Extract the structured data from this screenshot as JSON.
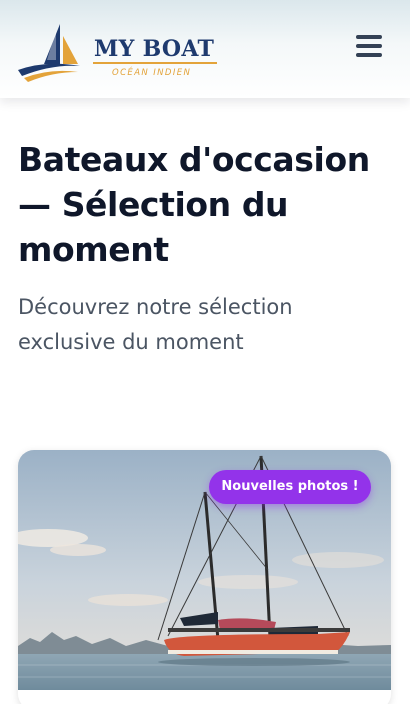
{
  "header": {
    "logo": {
      "title": "MY BOAT",
      "subtitle": "OCÉAN INDIEN",
      "icon": "sailboat-logo-icon"
    },
    "menu_icon": "hamburger-menu-icon"
  },
  "main": {
    "title": "Bateaux d'occasion — Sélection du moment",
    "subtitle": "Découvrez notre sélection exclusive du moment"
  },
  "listing": {
    "badge": "Nouvelles photos !",
    "image": "sailboat-photo"
  },
  "colors": {
    "brand_navy": "#1e3a6e",
    "brand_gold": "#e3a33a",
    "badge_purple": "#9333ea",
    "title_text": "#0f172a",
    "subtitle_text": "#4b5563"
  }
}
